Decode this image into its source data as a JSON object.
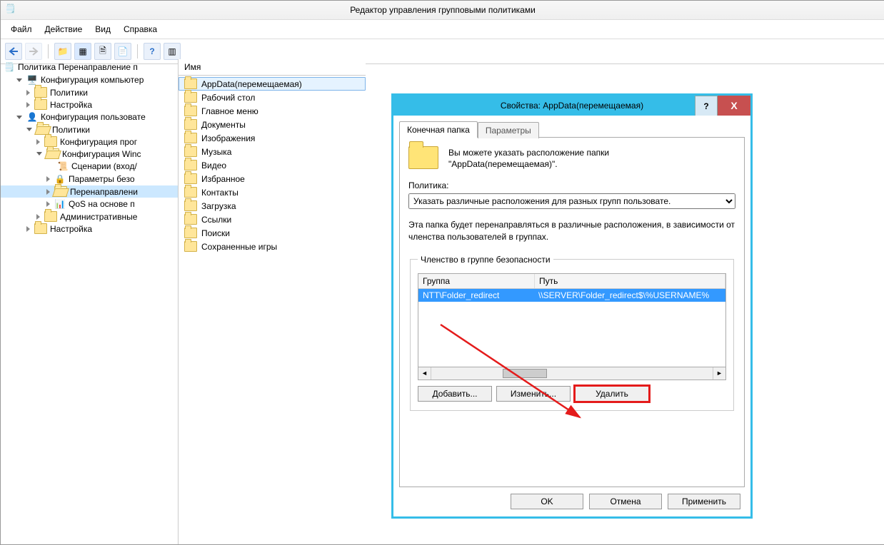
{
  "title": "Редактор управления групповыми политиками",
  "menu": {
    "file": "Файл",
    "action": "Действие",
    "view": "Вид",
    "help": "Справка"
  },
  "tree": {
    "root": "Политика Перенаправление п",
    "items": [
      {
        "ind": 1,
        "tw": "o",
        "icon": "comp",
        "label": "Конфигурация компьютер"
      },
      {
        "ind": 2,
        "tw": "c",
        "icon": "folder",
        "label": "Политики"
      },
      {
        "ind": 2,
        "tw": "c",
        "icon": "folder",
        "label": "Настройка"
      },
      {
        "ind": 1,
        "tw": "o",
        "icon": "user",
        "label": "Конфигурация пользовате"
      },
      {
        "ind": 2,
        "tw": "o",
        "icon": "folder-open",
        "label": "Политики"
      },
      {
        "ind": 3,
        "tw": "c",
        "icon": "folder",
        "label": "Конфигурация прог"
      },
      {
        "ind": 3,
        "tw": "o",
        "icon": "folder-open",
        "label": "Конфигурация Winc"
      },
      {
        "ind": 4,
        "tw": "n",
        "icon": "script",
        "label": "Сценарии (вход/"
      },
      {
        "ind": 4,
        "tw": "c",
        "icon": "lock",
        "label": "Параметры безо"
      },
      {
        "ind": 4,
        "tw": "c",
        "icon": "folder-open",
        "label": "Перенаправлени",
        "sel": true
      },
      {
        "ind": 4,
        "tw": "c",
        "icon": "qos",
        "label": "QoS на основе п"
      },
      {
        "ind": 3,
        "tw": "c",
        "icon": "folder",
        "label": "Административные"
      },
      {
        "ind": 2,
        "tw": "c",
        "icon": "folder",
        "label": "Настройка"
      }
    ]
  },
  "list": {
    "header": "Имя",
    "items": [
      "AppData(перемещаемая)",
      "Рабочий стол",
      "Главное меню",
      "Документы",
      "Изображения",
      "Музыка",
      "Видео",
      "Избранное",
      "Контакты",
      "Загрузка",
      "Ссылки",
      "Поиски",
      "Сохраненные игры"
    ]
  },
  "dialog": {
    "title": "Свойства: AppData(перемещаемая)",
    "help": "?",
    "close": "X",
    "tabs": {
      "target": "Конечная папка",
      "params": "Параметры"
    },
    "desc1": "Вы можете указать расположение папки",
    "desc2": "\"AppData(перемещаемая)\".",
    "policyLabel": "Политика:",
    "policyValue": "Указать различные расположения для разных групп пользовате.",
    "note": "Эта папка будет перенаправляться в различные расположения, в зависимости от членства пользователей в группах.",
    "groupLegend": "Членство в группе безопасности",
    "cols": {
      "group": "Группа",
      "path": "Путь"
    },
    "rowGroup": "NTT\\Folder_redirect",
    "rowPath": "\\\\SERVER\\Folder_redirect$\\%USERNAME%",
    "btnAdd": "Добавить...",
    "btnEdit": "Изменить...",
    "btnDel": "Удалить",
    "ok": "OK",
    "cancel": "Отмена",
    "apply": "Применить"
  }
}
